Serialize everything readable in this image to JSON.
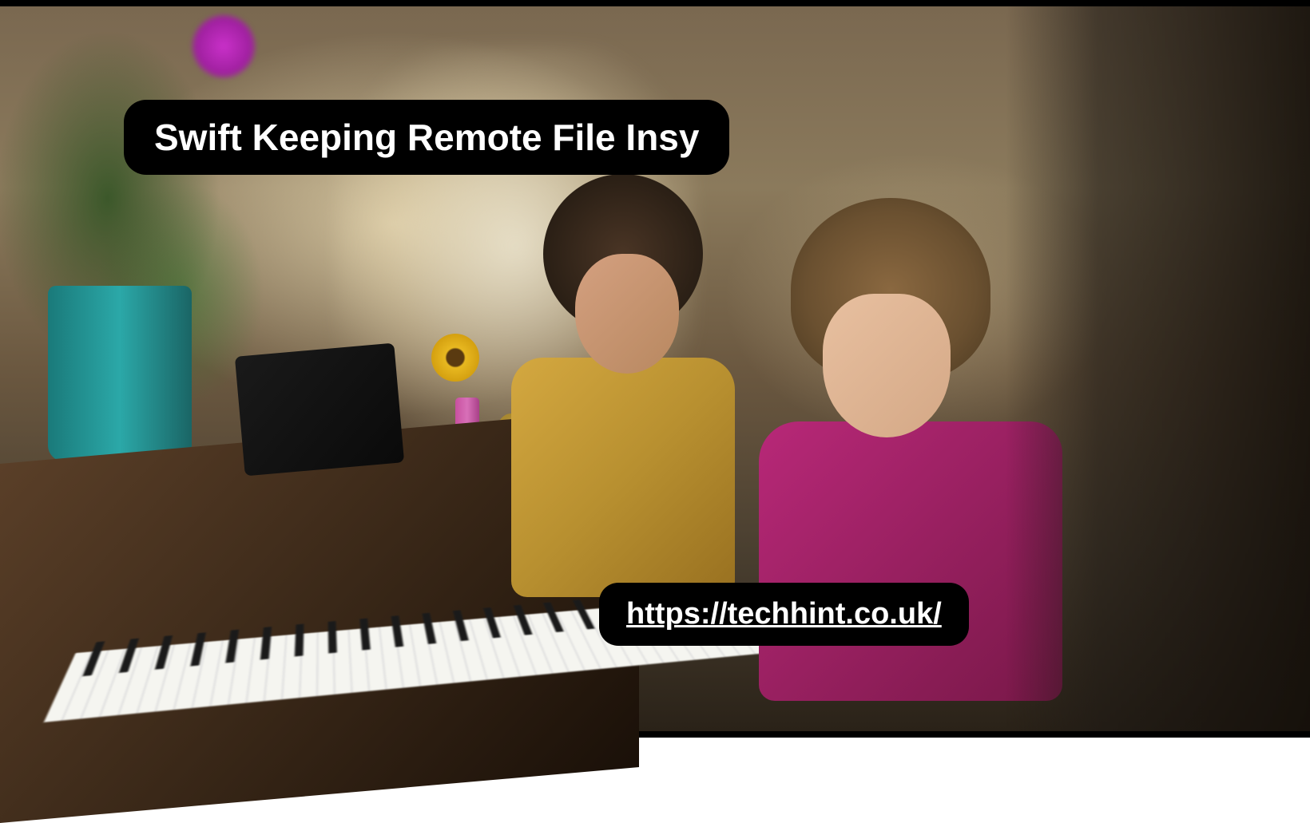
{
  "overlay": {
    "title": "Swift Keeping Remote File Insy",
    "url": "https://techhint.co.uk/"
  }
}
